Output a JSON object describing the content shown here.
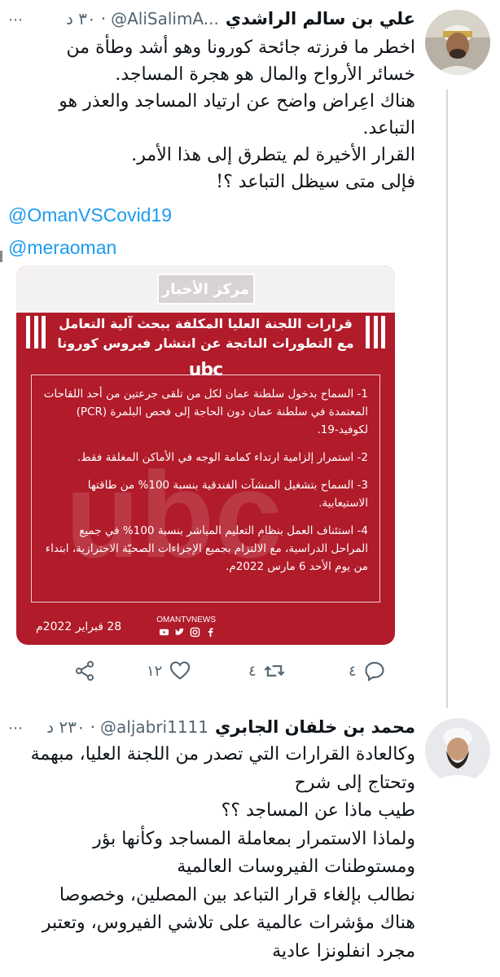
{
  "tweet1": {
    "name": "علي بن سالم الراشدي",
    "handle": "@AliSalimA...",
    "time": "٣٠ د",
    "text_lines": [
      "اخطر ما فرزته جائحة كورونا وهو أشد وطأة من",
      "خسائر الأرواح والمال هو هجرة المساجد.",
      "هناك اعِراض واضح عن ارتياد المساجد والعذر هو",
      "التباعد.",
      "القرار الأخيرة لم يتطرق إلى هذا الأمر.",
      "فإلى متى سيظل التباعد ؟!"
    ],
    "mentions": [
      "@OmanVSCovid19",
      "@meraoman"
    ],
    "card": {
      "badge": "مركز الأخبار",
      "title_lines": [
        "قرارات اللجنة العليا المكلفة ببحث آلية التعامل",
        "مع التطورات الناتجة عن انتشار فيروس كورونا"
      ],
      "logo": "ubc",
      "watermark": "ubc",
      "decisions": [
        "1- السماح بدخول سلطنة عمان لكل من تلقى جرعتين من أحد اللقاحات المعتمدة في سلطنة عمان دون الحاجة إلى فحص البلمرة (PCR) لكوفيد-19.",
        "2- استمرار إلزامية ارتداء كمامة الوجه في الأماكن المغلقة فقط.",
        "3- السماح بتشغيل المنشآت الفندقية بنسبة 100% من طاقتها الاستيعابية.",
        "4- استئناف العمل بنظام التعليم المباشر بنسبة 100% في جميع المراحل الدراسية، مع الالتزام بجميع الإجراءات الصحيّة الاحترازية، ابتداء من يوم الأحد 6 مارس 2022م."
      ],
      "date": "28 فبراير 2022م",
      "brand": "OMANTVNEWS"
    },
    "actions": {
      "reply_count": "٤",
      "retweet_count": "٤",
      "like_count": "١٢"
    }
  },
  "tweet2": {
    "name": "محمد بن خلفان الجابري",
    "handle": "@aljabri1111",
    "time": "٢٣٠ د",
    "text_lines": [
      "وكالعادة القرارات التي تصدر من اللجنة العليا، مبهمة",
      "وتحتاج إلى شرح",
      "طيب ماذا عن المساجد ؟؟",
      "ولماذا الاستمرار بمعاملة المساجد وكأنها بؤر",
      "ومستوطنات الفيروسات العالمية",
      "نطالب بإلغاء قرار التباعد بين المصلين، وخصوصا",
      "هناك مؤشرات عالمية على تلاشي الفيروس، وتعتبر",
      "مجرد انفلونزا عادية"
    ]
  }
}
